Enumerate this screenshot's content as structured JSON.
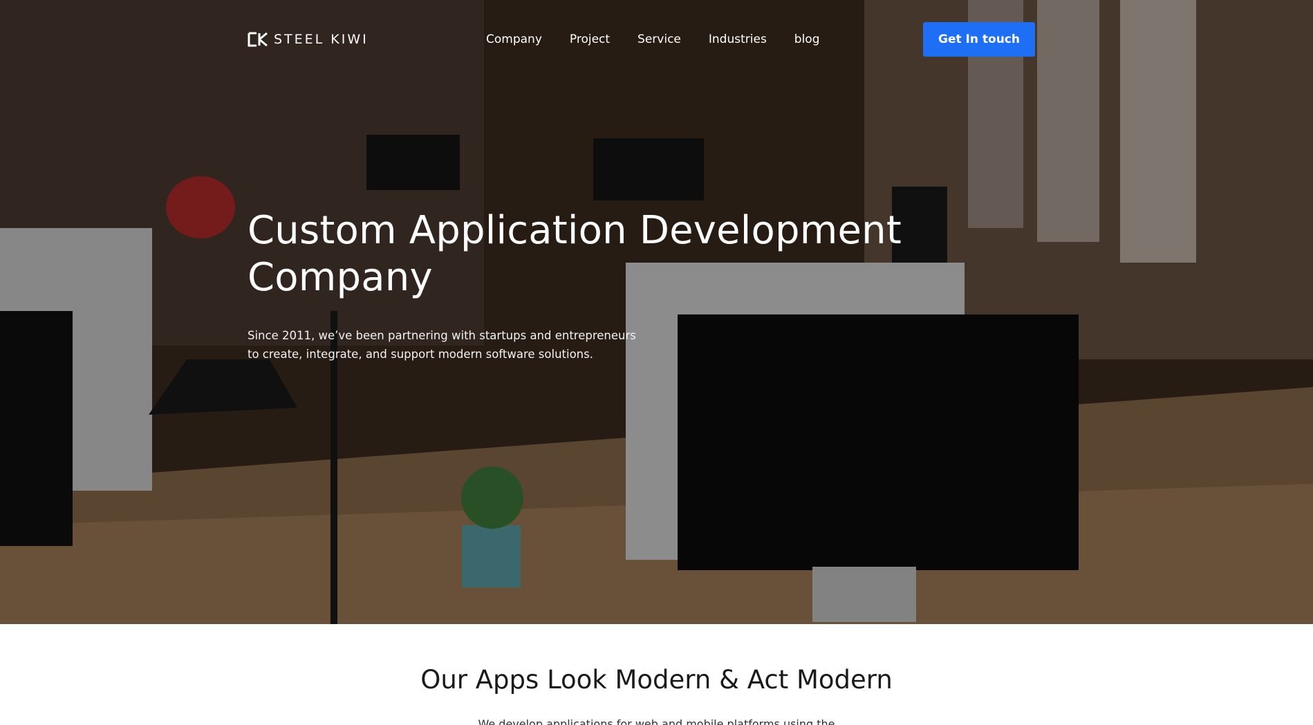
{
  "brand": {
    "name": "STEEL KIWI",
    "logo_icon": "sk-monogram-icon"
  },
  "nav": {
    "items": [
      {
        "label": "Company"
      },
      {
        "label": "Project"
      },
      {
        "label": "Service"
      },
      {
        "label": "Industries"
      },
      {
        "label": "blog"
      }
    ],
    "cta_label": "Get In touch"
  },
  "hero": {
    "headline": "Custom Application Development Company",
    "subtitle": "Since 2011, we’ve been partnering with startups and entrepreneurs to create, integrate, and support modern software solutions.",
    "background": "office-workspace-photo"
  },
  "section": {
    "title": "Our Apps Look Modern & Act Modern",
    "subtitle": "We develop applications for web and mobile platforms using the"
  },
  "colors": {
    "accent": "#1e6ff5",
    "hero_text": "#ffffff",
    "body_text": "#1a1a1a"
  }
}
